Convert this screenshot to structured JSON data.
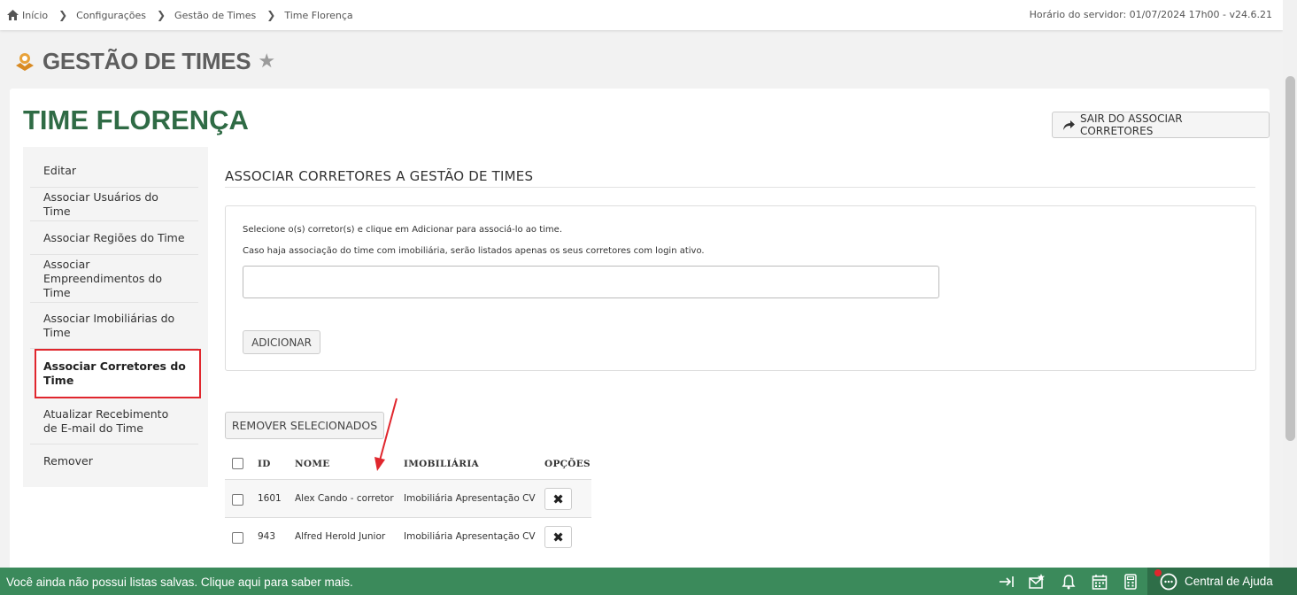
{
  "breadcrumb": [
    "Início",
    "Configurações",
    "Gestão de Times",
    "Time Florença"
  ],
  "server_time": "Horário do servidor: 01/07/2024 17h00 - v24.6.21",
  "page_title": "GESTÃO DE TIMES",
  "team_title": "TIME FLORENÇA",
  "exit_button": "SAIR DO ASSOCIAR CORRETORES",
  "sidebar": {
    "items": [
      "Editar",
      "Associar Usuários do Time",
      "Associar Regiões do Time",
      "Associar Empreendimentos do Time",
      "Associar Imobiliárias do Time",
      "Associar Corretores do Time",
      "Atualizar Recebimento de E-mail do Time",
      "Remover"
    ],
    "active_index": 5
  },
  "section_title": "ASSOCIAR CORRETORES A GESTÃO DE TIMES",
  "hints": [
    "Selecione o(s) corretor(s) e clique em Adicionar para associá-lo ao time.",
    "Caso haja associação do time com imobiliária, serão listados apenas os seus corretores com login ativo."
  ],
  "add_button": "ADICIONAR",
  "remove_selected_button": "REMOVER SELECIONADOS",
  "table": {
    "headers": [
      "ID",
      "NOME",
      "IMOBILIÁRIA",
      "OPÇÕES"
    ],
    "rows": [
      {
        "id": "1601",
        "nome": "Alex Cando - corretor",
        "imobiliaria": "Imobiliária Apresentação CV"
      },
      {
        "id": "943",
        "nome": "Alfred Herold Junior",
        "imobiliaria": "Imobiliária Apresentação CV"
      }
    ]
  },
  "bottom_bar": {
    "message": "Você ainda não possui listas salvas. Clique aqui para saber mais.",
    "help_label": "Central de Ajuda"
  },
  "colors": {
    "brand_green": "#2f6b45",
    "bottom_bar": "#3b8a5b",
    "active_border": "#e0262d"
  }
}
